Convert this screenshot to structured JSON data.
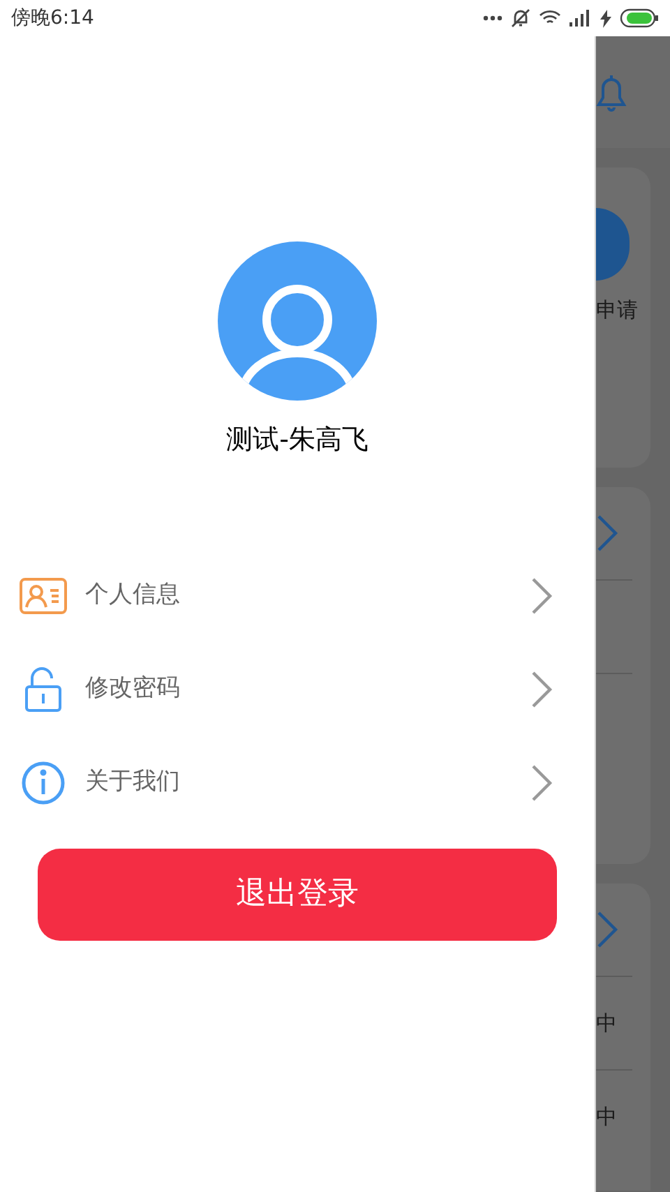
{
  "status_bar": {
    "time": "傍晚6:14"
  },
  "drawer": {
    "user_name": "测试-朱高飞",
    "menu": [
      {
        "kind": "profile",
        "label": "个人信息"
      },
      {
        "kind": "lock",
        "label": "修改密码"
      },
      {
        "kind": "info",
        "label": "关于我们"
      }
    ],
    "logout_button": "退出登录"
  },
  "background_app": {
    "card_label": "申请",
    "row_labels": [
      "中",
      "中"
    ]
  }
}
